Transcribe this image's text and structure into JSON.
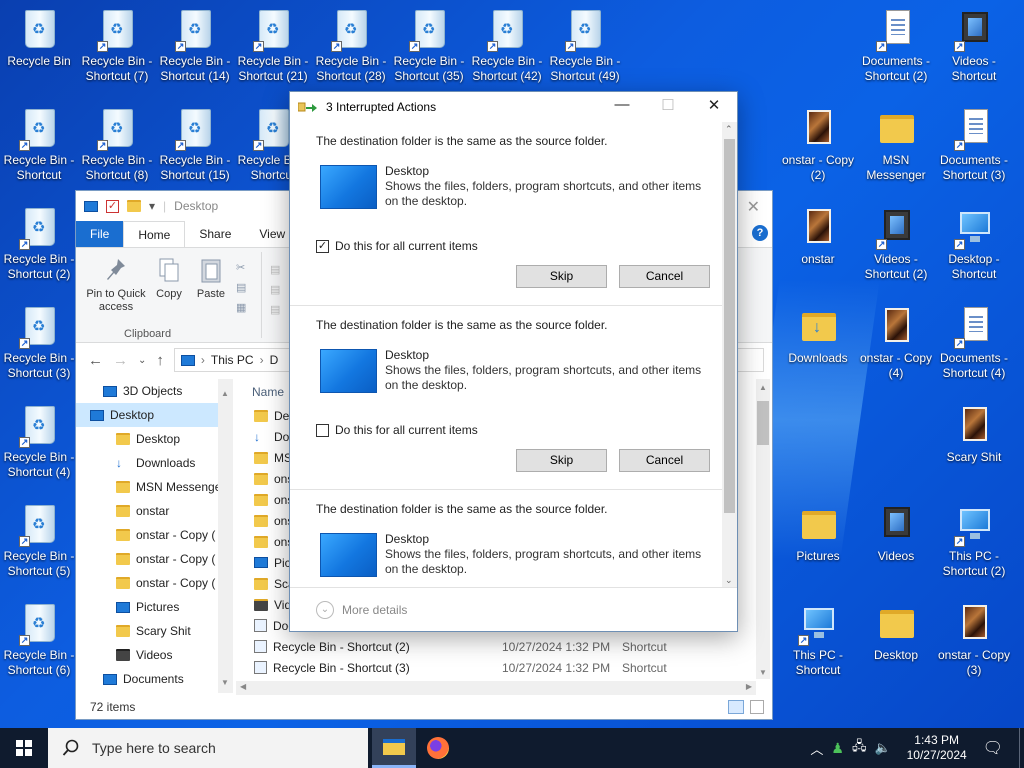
{
  "desktop": {
    "icons": [
      {
        "label": "Recycle Bin",
        "kind": "bin",
        "shortcut": false
      },
      {
        "label": "Recycle Bin -\nShortcut (7)",
        "kind": "bin",
        "shortcut": true
      },
      {
        "label": "Recycle Bin -\nShortcut (14)",
        "kind": "bin",
        "shortcut": true
      },
      {
        "label": "Recycle Bin -\nShortcut (21)",
        "kind": "bin",
        "shortcut": true
      },
      {
        "label": "Recycle Bin -\nShortcut (28)",
        "kind": "bin",
        "shortcut": true
      },
      {
        "label": "Recycle Bin -\nShortcut (35)",
        "kind": "bin",
        "shortcut": true
      },
      {
        "label": "Recycle Bin -\nShortcut (42)",
        "kind": "bin",
        "shortcut": true
      },
      {
        "label": "Recycle Bin -\nShortcut (49)",
        "kind": "bin",
        "shortcut": true
      },
      {
        "label": "Recycle Bin -\nShortcut",
        "kind": "bin",
        "shortcut": true
      },
      {
        "label": "Recycle Bin -\nShortcut (8)",
        "kind": "bin",
        "shortcut": true
      },
      {
        "label": "Recycle Bin -\nShortcut (15)",
        "kind": "bin",
        "shortcut": true
      },
      {
        "label": "Recycle Bin -\nShortcut",
        "kind": "bin",
        "shortcut": true
      },
      {
        "label": "Recycle Bin -\nShortcut (2)",
        "kind": "bin",
        "shortcut": true
      },
      {
        "label": "Recycle Bin -\nShortcut (3)",
        "kind": "bin",
        "shortcut": true
      },
      {
        "label": "Recycle Bin -\nShortcut (4)",
        "kind": "bin",
        "shortcut": true
      },
      {
        "label": "Recycle Bin -\nShortcut (5)",
        "kind": "bin",
        "shortcut": true
      },
      {
        "label": "Recycle Bin -\nShortcut (6)",
        "kind": "bin",
        "shortcut": true
      },
      {
        "label": "Documents -\nShortcut (2)",
        "kind": "doc",
        "shortcut": true
      },
      {
        "label": "Videos -\nShortcut",
        "kind": "film",
        "shortcut": true
      },
      {
        "label": "onstar - Copy\n(2)",
        "kind": "photo",
        "shortcut": false
      },
      {
        "label": "MSN\nMessenger",
        "kind": "folder",
        "shortcut": false
      },
      {
        "label": "Documents -\nShortcut (3)",
        "kind": "doc",
        "shortcut": true
      },
      {
        "label": "onstar",
        "kind": "photo",
        "shortcut": false
      },
      {
        "label": "Videos -\nShortcut (2)",
        "kind": "film",
        "shortcut": true
      },
      {
        "label": "Desktop -\nShortcut",
        "kind": "pc",
        "shortcut": true
      },
      {
        "label": "Downloads",
        "kind": "download",
        "shortcut": false
      },
      {
        "label": "onstar - Copy\n(4)",
        "kind": "photo",
        "shortcut": false
      },
      {
        "label": "Documents -\nShortcut (4)",
        "kind": "doc",
        "shortcut": true
      },
      {
        "label": "Scary Shit",
        "kind": "photo",
        "shortcut": false
      },
      {
        "label": "Pictures",
        "kind": "folder",
        "shortcut": false
      },
      {
        "label": "Videos",
        "kind": "film",
        "shortcut": false
      },
      {
        "label": "This PC -\nShortcut (2)",
        "kind": "pc",
        "shortcut": true
      },
      {
        "label": "This PC -\nShortcut",
        "kind": "pc",
        "shortcut": true
      },
      {
        "label": "Desktop",
        "kind": "folder",
        "shortcut": false
      },
      {
        "label": "onstar - Copy\n(3)",
        "kind": "photo",
        "shortcut": false
      }
    ]
  },
  "explorer": {
    "title": "Desktop",
    "tabs": [
      "File",
      "Home",
      "Share",
      "View"
    ],
    "ribbon": {
      "pin_label": "Pin to Quick access",
      "copy_label": "Copy",
      "paste_label": "Paste",
      "group_label": "Clipboard"
    },
    "breadcrumb": [
      "This PC",
      "D"
    ],
    "nav_items": [
      {
        "label": "3D Objects",
        "icon": "cube-icon",
        "indent": 1
      },
      {
        "label": "Desktop",
        "icon": "desktop-icon",
        "indent": 0,
        "selected": true
      },
      {
        "label": "Desktop",
        "icon": "folder-icon",
        "indent": 2
      },
      {
        "label": "Downloads",
        "icon": "download-icon",
        "indent": 2
      },
      {
        "label": "MSN Messenger",
        "icon": "folder-icon",
        "indent": 2
      },
      {
        "label": "onstar",
        "icon": "folder-icon",
        "indent": 2
      },
      {
        "label": "onstar - Copy (",
        "icon": "folder-icon",
        "indent": 2
      },
      {
        "label": "onstar - Copy (",
        "icon": "folder-icon",
        "indent": 2
      },
      {
        "label": "onstar - Copy (",
        "icon": "folder-icon",
        "indent": 2
      },
      {
        "label": "Pictures",
        "icon": "pictures-icon",
        "indent": 2
      },
      {
        "label": "Scary Shit",
        "icon": "folder-icon",
        "indent": 2
      },
      {
        "label": "Videos",
        "icon": "film-icon",
        "indent": 2
      },
      {
        "label": "Documents",
        "icon": "doc-icon",
        "indent": 1
      }
    ],
    "column_name": "Name",
    "files": [
      {
        "name": "De",
        "date": "",
        "type": "",
        "icon": "folder-icon"
      },
      {
        "name": "Do",
        "date": "",
        "type": "",
        "icon": "download-icon"
      },
      {
        "name": "MS",
        "date": "",
        "type": "",
        "icon": "folder-icon"
      },
      {
        "name": "ons",
        "date": "",
        "type": "",
        "icon": "folder-icon"
      },
      {
        "name": "ons",
        "date": "",
        "type": "",
        "icon": "folder-icon"
      },
      {
        "name": "ons",
        "date": "",
        "type": "",
        "icon": "folder-icon"
      },
      {
        "name": "ons",
        "date": "",
        "type": "",
        "icon": "folder-icon"
      },
      {
        "name": "Pic",
        "date": "",
        "type": "",
        "icon": "pictures-icon"
      },
      {
        "name": "Sca",
        "date": "",
        "type": "",
        "icon": "folder-icon"
      },
      {
        "name": "Vid",
        "date": "",
        "type": "",
        "icon": "film-icon"
      },
      {
        "name": "Documents - Shortcut",
        "date": "10/27/2024 1:39 PM",
        "type": "Shortcut",
        "icon": "shortcut-icon"
      },
      {
        "name": "Recycle Bin - Shortcut (2)",
        "date": "10/27/2024 1:32 PM",
        "type": "Shortcut",
        "icon": "shortcut-icon"
      },
      {
        "name": "Recycle Bin - Shortcut (3)",
        "date": "10/27/2024 1:32 PM",
        "type": "Shortcut",
        "icon": "shortcut-icon"
      }
    ],
    "status": "72 items"
  },
  "dialog": {
    "title": "3 Interrupted Actions",
    "conflicts": [
      {
        "message": "The destination folder is the same as the source folder.",
        "name": "Desktop",
        "description": "Shows the files, folders, program shortcuts, and other items on the desktop.",
        "checkbox_label": "Do this for all current items",
        "checked": true,
        "skip": "Skip",
        "cancel": "Cancel"
      },
      {
        "message": "The destination folder is the same as the source folder.",
        "name": "Desktop",
        "description": "Shows the files, folders, program shortcuts, and other items on the desktop.",
        "checkbox_label": "Do this for all current items",
        "checked": false,
        "skip": "Skip",
        "cancel": "Cancel"
      },
      {
        "message": "The destination folder is the same as the source folder.",
        "name": "Desktop",
        "description": "Shows the files, folders, program shortcuts, and other items on the desktop.",
        "checkbox_label": "",
        "checked": false,
        "skip": "",
        "cancel": ""
      }
    ],
    "more_details": "More details"
  },
  "taskbar": {
    "search_placeholder": "Type here to search",
    "time": "1:43 PM",
    "date": "10/27/2024"
  }
}
